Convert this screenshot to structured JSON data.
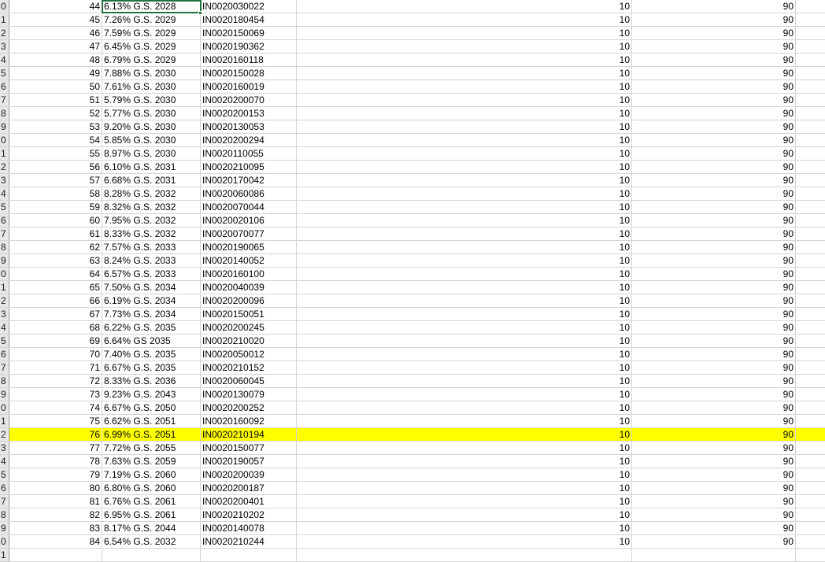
{
  "sheet": {
    "rows": [
      {
        "row_header": "0",
        "sr": "44",
        "security": "6.13% G.S. 2028",
        "isin": "IN0020030022",
        "val1": "10",
        "val2": "90"
      },
      {
        "row_header": "1",
        "sr": "45",
        "security": "7.26% G.S. 2029",
        "isin": "IN0020180454",
        "val1": "10",
        "val2": "90"
      },
      {
        "row_header": "2",
        "sr": "46",
        "security": "7.59% G.S. 2029",
        "isin": "IN0020150069",
        "val1": "10",
        "val2": "90"
      },
      {
        "row_header": "3",
        "sr": "47",
        "security": "6.45% G.S. 2029",
        "isin": "IN0020190362",
        "val1": "10",
        "val2": "90"
      },
      {
        "row_header": "4",
        "sr": "48",
        "security": "6.79% G.S. 2029",
        "isin": "IN0020160118",
        "val1": "10",
        "val2": "90"
      },
      {
        "row_header": "5",
        "sr": "49",
        "security": "7.88% G.S. 2030",
        "isin": "IN0020150028",
        "val1": "10",
        "val2": "90"
      },
      {
        "row_header": "6",
        "sr": "50",
        "security": "7.61% G.S. 2030",
        "isin": "IN0020160019",
        "val1": "10",
        "val2": "90"
      },
      {
        "row_header": "7",
        "sr": "51",
        "security": "5.79% G.S. 2030",
        "isin": "IN0020200070",
        "val1": "10",
        "val2": "90"
      },
      {
        "row_header": "8",
        "sr": "52",
        "security": "5.77% G.S. 2030",
        "isin": "IN0020200153",
        "val1": "10",
        "val2": "90"
      },
      {
        "row_header": "9",
        "sr": "53",
        "security": "9.20% G.S. 2030",
        "isin": "IN0020130053",
        "val1": "10",
        "val2": "90"
      },
      {
        "row_header": "0",
        "sr": "54",
        "security": "5.85% G.S. 2030",
        "isin": "IN0020200294",
        "val1": "10",
        "val2": "90"
      },
      {
        "row_header": "1",
        "sr": "55",
        "security": "8.97% G.S. 2030",
        "isin": "IN0020110055",
        "val1": "10",
        "val2": "90"
      },
      {
        "row_header": "2",
        "sr": "56",
        "security": "6.10% G.S. 2031",
        "isin": "IN0020210095",
        "val1": "10",
        "val2": "90"
      },
      {
        "row_header": "3",
        "sr": "57",
        "security": "6.68% G.S. 2031",
        "isin": "IN0020170042",
        "val1": "10",
        "val2": "90"
      },
      {
        "row_header": "4",
        "sr": "58",
        "security": "8.28% G.S. 2032",
        "isin": "IN0020060086",
        "val1": "10",
        "val2": "90"
      },
      {
        "row_header": "5",
        "sr": "59",
        "security": "8.32% G.S. 2032",
        "isin": "IN0020070044",
        "val1": "10",
        "val2": "90"
      },
      {
        "row_header": "6",
        "sr": "60",
        "security": "7.95% G.S. 2032",
        "isin": "IN0020020106",
        "val1": "10",
        "val2": "90"
      },
      {
        "row_header": "7",
        "sr": "61",
        "security": "8.33% G.S. 2032",
        "isin": "IN0020070077",
        "val1": "10",
        "val2": "90"
      },
      {
        "row_header": "8",
        "sr": "62",
        "security": "7.57% G.S. 2033",
        "isin": "IN0020190065",
        "val1": "10",
        "val2": "90"
      },
      {
        "row_header": "9",
        "sr": "63",
        "security": "8.24% G.S. 2033",
        "isin": "IN0020140052",
        "val1": "10",
        "val2": "90"
      },
      {
        "row_header": "0",
        "sr": "64",
        "security": "6.57% G.S. 2033",
        "isin": "IN0020160100",
        "val1": "10",
        "val2": "90"
      },
      {
        "row_header": "1",
        "sr": "65",
        "security": "7.50% G.S. 2034",
        "isin": "IN0020040039",
        "val1": "10",
        "val2": "90"
      },
      {
        "row_header": "2",
        "sr": "66",
        "security": "6.19% G.S. 2034",
        "isin": "IN0020200096",
        "val1": "10",
        "val2": "90"
      },
      {
        "row_header": "3",
        "sr": "67",
        "security": "7.73% G.S. 2034",
        "isin": "IN0020150051",
        "val1": "10",
        "val2": "90"
      },
      {
        "row_header": "4",
        "sr": "68",
        "security": "6.22% G.S. 2035",
        "isin": "IN0020200245",
        "val1": "10",
        "val2": "90"
      },
      {
        "row_header": "5",
        "sr": "69",
        "security": "6.64% GS 2035",
        "isin": "IN0020210020",
        "val1": "10",
        "val2": "90"
      },
      {
        "row_header": "6",
        "sr": "70",
        "security": "7.40% G.S. 2035",
        "isin": "IN0020050012",
        "val1": "10",
        "val2": "90"
      },
      {
        "row_header": "7",
        "sr": "71",
        "security": "6.67% G.S. 2035",
        "isin": "IN0020210152",
        "val1": "10",
        "val2": "90"
      },
      {
        "row_header": "8",
        "sr": "72",
        "security": "8.33% G.S. 2036",
        "isin": "IN0020060045",
        "val1": "10",
        "val2": "90"
      },
      {
        "row_header": "9",
        "sr": "73",
        "security": "9.23% G.S. 2043",
        "isin": "IN0020130079",
        "val1": "10",
        "val2": "90"
      },
      {
        "row_header": "0",
        "sr": "74",
        "security": "6.67% G.S. 2050",
        "isin": "IN0020200252",
        "val1": "10",
        "val2": "90"
      },
      {
        "row_header": "1",
        "sr": "75",
        "security": "6.62% G.S. 2051",
        "isin": "IN0020160092",
        "val1": "10",
        "val2": "90"
      },
      {
        "row_header": "2",
        "sr": "76",
        "security": "6.99% G.S. 2051",
        "isin": "IN0020210194",
        "val1": "10",
        "val2": "90",
        "highlight": true
      },
      {
        "row_header": "3",
        "sr": "77",
        "security": "7.72% G.S. 2055",
        "isin": "IN0020150077",
        "val1": "10",
        "val2": "90"
      },
      {
        "row_header": "4",
        "sr": "78",
        "security": "7.63% G.S. 2059",
        "isin": "IN0020190057",
        "val1": "10",
        "val2": "90"
      },
      {
        "row_header": "5",
        "sr": "79",
        "security": "7.19% G.S. 2060",
        "isin": "IN0020200039",
        "val1": "10",
        "val2": "90"
      },
      {
        "row_header": "6",
        "sr": "80",
        "security": "6.80% G.S. 2060",
        "isin": "IN0020200187",
        "val1": "10",
        "val2": "90"
      },
      {
        "row_header": "7",
        "sr": "81",
        "security": "6.76% G.S. 2061",
        "isin": "IN0020200401",
        "val1": "10",
        "val2": "90"
      },
      {
        "row_header": "8",
        "sr": "82",
        "security": "6.95% G.S. 2061",
        "isin": "IN0020210202",
        "val1": "10",
        "val2": "90"
      },
      {
        "row_header": "9",
        "sr": "83",
        "security": "8.17% G.S. 2044",
        "isin": "IN0020140078",
        "val1": "10",
        "val2": "90"
      },
      {
        "row_header": "0",
        "sr": "84",
        "security": "6.54% G.S. 2032",
        "isin": "IN0020210244",
        "val1": "10",
        "val2": "90"
      },
      {
        "row_header": "1",
        "sr": "",
        "security": "",
        "isin": "",
        "val1": "",
        "val2": ""
      }
    ]
  },
  "colors": {
    "highlight": "#ffff00",
    "selection": "#217346",
    "gridline": "#d4d4d4",
    "row_header_bg": "#e6e6e6"
  }
}
